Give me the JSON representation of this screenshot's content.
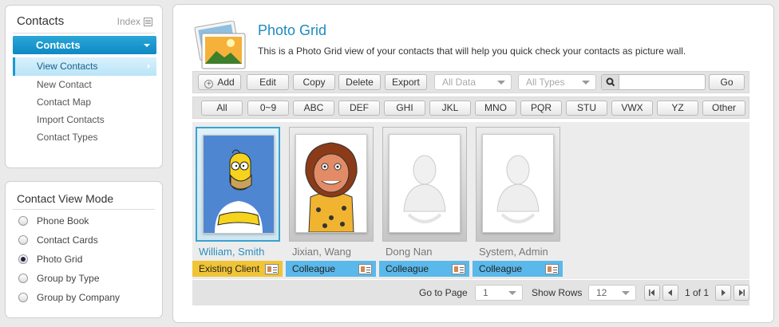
{
  "nav": {
    "title": "Contacts",
    "index_label": "Index",
    "header_button": "Contacts",
    "items": [
      "View Contacts",
      "New Contact",
      "Contact Map",
      "Import Contacts",
      "Contact Types"
    ]
  },
  "mode": {
    "title": "Contact View Mode",
    "options": [
      "Phone Book",
      "Contact Cards",
      "Photo Grid",
      "Group by Type",
      "Group by Company"
    ],
    "selected": "Photo Grid"
  },
  "main": {
    "title": "Photo Grid",
    "description": "This is a Photo Grid view of your contacts that will help you quick check your contacts as picture wall."
  },
  "toolbar": {
    "add": "Add",
    "edit": "Edit",
    "copy": "Copy",
    "delete": "Delete",
    "export": "Export",
    "data_filter": "All Data",
    "type_filter": "All Types",
    "search_value": "",
    "go": "Go"
  },
  "letters": [
    "All",
    "0~9",
    "ABC",
    "DEF",
    "GHI",
    "JKL",
    "MNO",
    "PQR",
    "STU",
    "VWX",
    "YZ",
    "Other"
  ],
  "contacts": [
    {
      "name": "William, Smith",
      "type": "Existing Client",
      "photo": "homer-cartoon"
    },
    {
      "name": "Jixian, Wang",
      "type": "Colleague",
      "photo": "caveman-cartoon"
    },
    {
      "name": "Dong Nan",
      "type": "Colleague",
      "photo": "placeholder"
    },
    {
      "name": "System, Admin",
      "type": "Colleague",
      "photo": "placeholder"
    }
  ],
  "pager": {
    "go_to_page": "Go to Page",
    "page": "1",
    "show_rows": "Show Rows",
    "rows": "12",
    "page_info": "1 of 1"
  },
  "colors": {
    "accent": "#1d98d3",
    "selected_tag": "#f0c436",
    "tag": "#5ab8ea"
  }
}
